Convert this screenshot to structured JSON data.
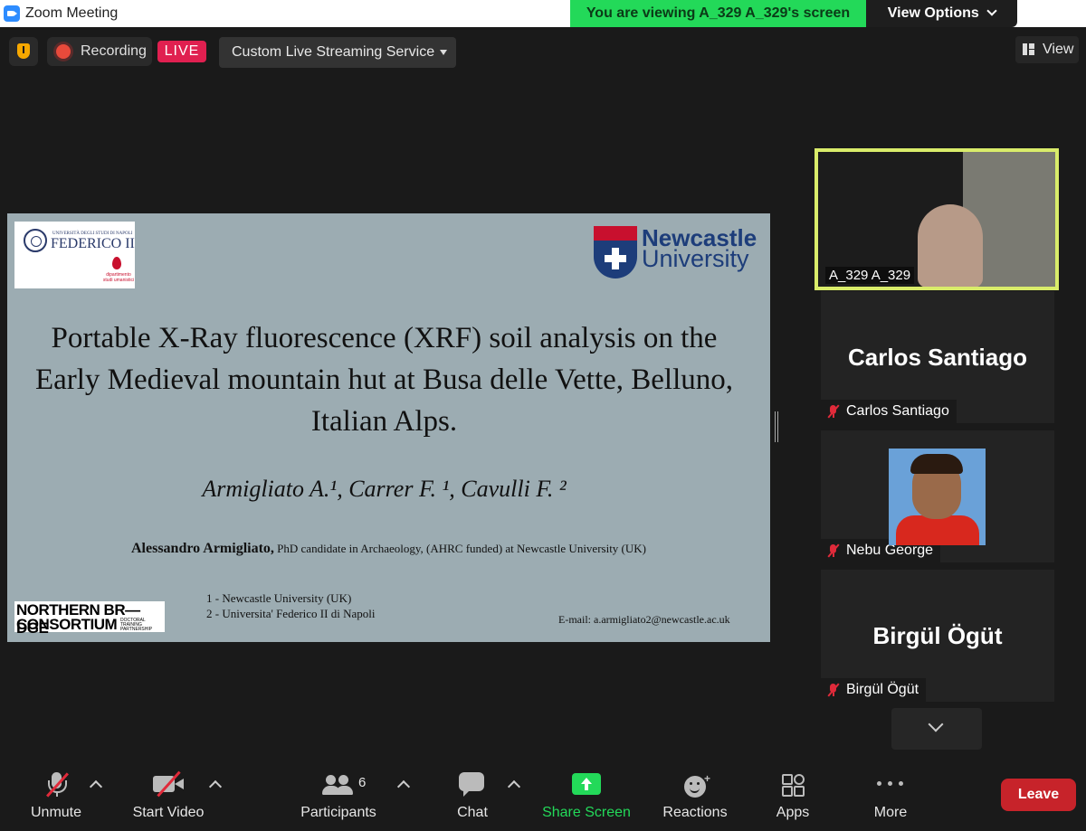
{
  "window": {
    "title": "Zoom Meeting"
  },
  "banner": {
    "viewing": "You are viewing A_329 A_329's screen",
    "view_options": "View Options"
  },
  "topbar": {
    "recording_label": "Recording",
    "live_badge": "LIVE",
    "streaming_service": "Custom Live Streaming Service",
    "view_label": "View"
  },
  "slide": {
    "federico_small": "UNIVERSITÀ DEGLI STUDI DI NAPOLI",
    "federico_name": "FEDERICO II",
    "federico_dept": "dipartimento studi umanistici",
    "ncl_line1": "Newcastle",
    "ncl_line2": "University",
    "title": "Portable X-Ray fluorescence (XRF) soil analysis on the Early Medieval mountain hut at Busa delle Vette, Belluno, Italian Alps.",
    "authors": "Armigliato A.¹, Carrer F. ¹, Cavulli F. ²",
    "presenter_name": "Alessandro Armigliato,",
    "presenter_role": "PhD candidate in Archaeology, (AHRC funded) at Newcastle University (UK)",
    "nbc_line1": "NORTHERN BR—DGE",
    "nbc_line2": "CONSORTIUM",
    "nbc_line3": "DOCTORAL TRAINING PARTNERSHIP",
    "affiliation1": "1 - Newcastle University (UK)",
    "affiliation2": "2 - Universita' Federico II di Napoli",
    "email": "E-mail: a.armigliato2@newcastle.ac.uk"
  },
  "participants_panel": [
    {
      "name": "A_329 A_329",
      "display": "video"
    },
    {
      "name": "Carlos Santiago",
      "display": "name"
    },
    {
      "name": "Nebu George",
      "display": "photo"
    },
    {
      "name": "Birgül Ögüt",
      "display": "name"
    }
  ],
  "toolbar": {
    "unmute": "Unmute",
    "start_video": "Start Video",
    "participants": "Participants",
    "participants_count": "6",
    "chat": "Chat",
    "share_screen": "Share Screen",
    "reactions": "Reactions",
    "apps": "Apps",
    "more": "More",
    "leave": "Leave"
  },
  "colors": {
    "banner_green": "#23d959",
    "live_red": "#e02050",
    "leave_red": "#c7232a",
    "active_speaker_border": "#d9ec6a",
    "share_green": "#23d959"
  }
}
